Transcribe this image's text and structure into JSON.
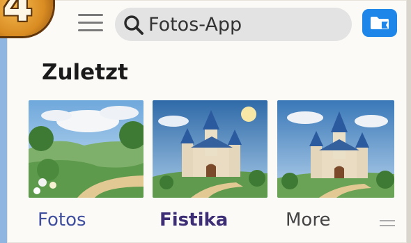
{
  "step": {
    "number": "4"
  },
  "search": {
    "value": "Fotos-App"
  },
  "recent": {
    "title": "Zuletzt"
  },
  "tabs": [
    {
      "label": "Fotos"
    },
    {
      "label": "Fistika"
    },
    {
      "label": "More"
    }
  ],
  "colors": {
    "accent": "#1e86e8",
    "badge": "#d98c22",
    "fotos_label": "#3f4f9e",
    "fistika_label": "#3c2d74"
  },
  "icons": {
    "menu": "hamburger-menu-icon",
    "search": "search-icon",
    "folder": "folder-icon",
    "handle": "drag-handle-icon"
  }
}
